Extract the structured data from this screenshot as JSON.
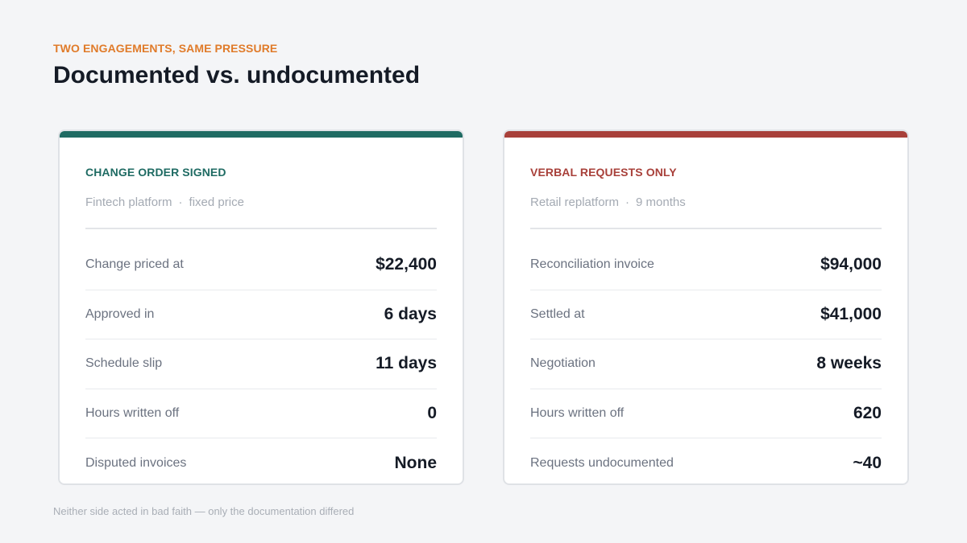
{
  "header": {
    "eyebrow": "TWO ENGAGEMENTS, SAME PRESSURE",
    "title": "Documented vs. undocumented"
  },
  "cards": [
    {
      "label": "CHANGE ORDER SIGNED",
      "sub_left": "Fintech platform",
      "sub_sep": "·",
      "sub_right": "fixed price",
      "accent": "#1f6b63",
      "rows": [
        {
          "label": "Change priced at",
          "value": "$22,400"
        },
        {
          "label": "Approved in",
          "value": "6 days"
        },
        {
          "label": "Schedule slip",
          "value": "11 days"
        },
        {
          "label": "Hours written off",
          "value": "0"
        },
        {
          "label": "Disputed invoices",
          "value": "None"
        }
      ]
    },
    {
      "label": "VERBAL REQUESTS ONLY",
      "sub_left": "Retail replatform",
      "sub_sep": "·",
      "sub_right": "9 months",
      "accent": "#a8403a",
      "rows": [
        {
          "label": "Reconciliation invoice",
          "value": "$94,000"
        },
        {
          "label": "Settled at",
          "value": "$41,000"
        },
        {
          "label": "Negotiation",
          "value": "8 weeks"
        },
        {
          "label": "Hours written off",
          "value": "620"
        },
        {
          "label": "Requests undocumented",
          "value": "~40"
        }
      ]
    }
  ],
  "footer": {
    "note": "Neither side acted in bad faith — only the documentation differed"
  },
  "colors": {
    "eyebrow": "#e07b2a",
    "background": "#f4f5f7"
  }
}
